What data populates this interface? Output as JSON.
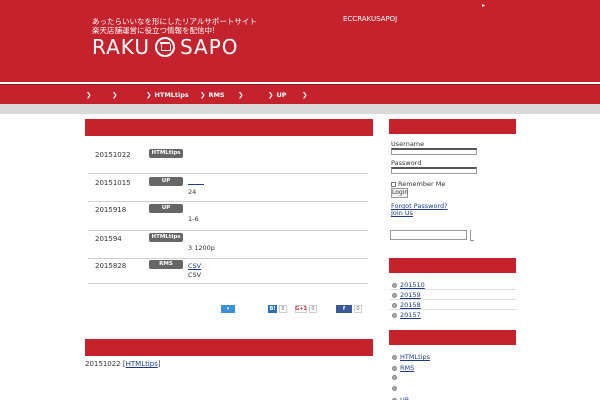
{
  "header": {
    "tagline_line1": "あったらいいなを形にしたリアルサポートサイト",
    "tagline_line2": "楽天店舗運営に役立つ情報を配信中!",
    "logo_left": "RAKU",
    "logo_right": "SAPO",
    "top_note": "ECCRAKUSAPOJ",
    "top_arrow": "▸"
  },
  "nav": {
    "chevron": "❯",
    "items": [
      "",
      "",
      "HTMLtips",
      "RMS",
      "",
      "UP",
      ""
    ]
  },
  "posts": [
    {
      "date": "20151022",
      "badge": "HTMLtips",
      "line1": "",
      "line2": ""
    },
    {
      "date": "20151015",
      "badge": "UP",
      "line1": "",
      "line2": "24"
    },
    {
      "date": "2015918",
      "badge": "UP",
      "line1": "",
      "line2": "1-6"
    },
    {
      "date": "201594",
      "badge": "HTMLtips",
      "line1": "",
      "line2": "3 1200p"
    },
    {
      "date": "2015828",
      "badge": "RMS",
      "line1": "CSV",
      "line2": "CSV"
    }
  ],
  "share": {
    "twitter_label": "▾",
    "hatena_label": "B!",
    "hatena_count": "0",
    "gplus_label": "G+1",
    "gplus_count": "0",
    "facebook_label": "f",
    "facebook_count": "0"
  },
  "post_line": {
    "date": "20151022",
    "category": "HTMLtips"
  },
  "login": {
    "username_label": "Username",
    "password_label": "Password",
    "remember_label": "Remember Me",
    "login_button": "Login",
    "forgot_link": "Forgot Password?",
    "join_link": "Join Us"
  },
  "archives": [
    "201510",
    "20159",
    "20158",
    "20157"
  ],
  "categories": [
    "HTMLtips",
    "RMS",
    "",
    "",
    "UP"
  ],
  "colors": {
    "brand_red": "#c4232e",
    "badge_gray": "#666666",
    "link_blue": "#1a3a8a"
  }
}
